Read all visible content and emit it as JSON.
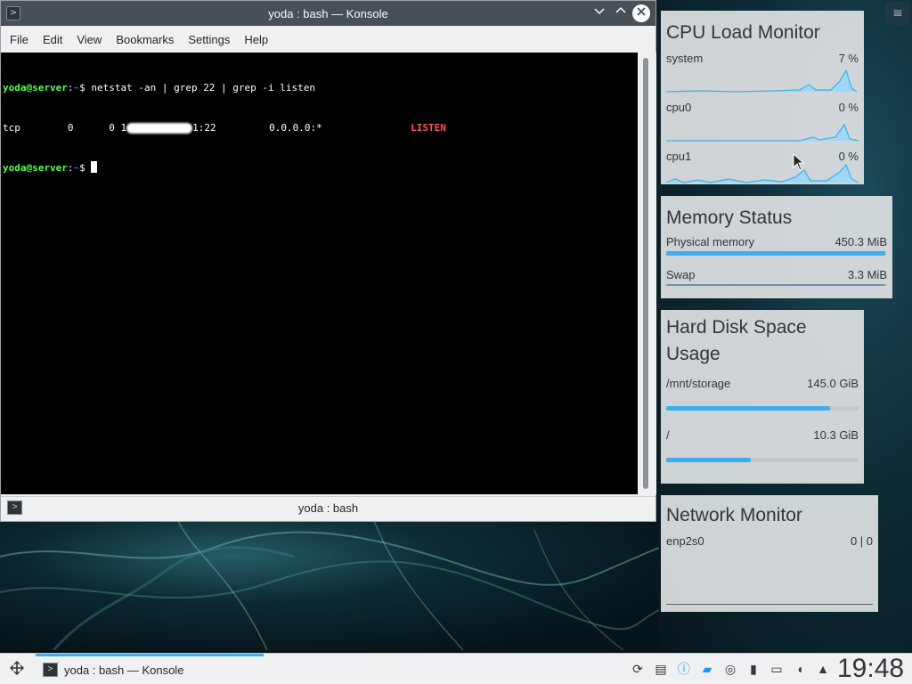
{
  "window": {
    "title": "yoda : bash — Konsole",
    "minimize_icon": "chevron-down-icon",
    "maximize_icon": "chevron-up-icon",
    "close_icon": "close-icon"
  },
  "menu": [
    "File",
    "Edit",
    "View",
    "Bookmarks",
    "Settings",
    "Help"
  ],
  "terminal": {
    "prompt_user": "yoda@server",
    "prompt_sep": ":",
    "prompt_path": "~",
    "prompt_end": "$ ",
    "command": "netstat -an | grep 22 | grep -i listen",
    "out_proto": "tcp        0      0 ",
    "out_local_prefix": "1",
    "out_local_suffix": "1:22         0.0.0.0:*               ",
    "out_state": "LISTEN"
  },
  "tab": {
    "label": "yoda : bash"
  },
  "cpu": {
    "title": "CPU Load Monitor",
    "rows": [
      {
        "name": "system",
        "value": "7 %"
      },
      {
        "name": "cpu0",
        "value": "0 %"
      },
      {
        "name": "cpu1",
        "value": "0 %"
      }
    ]
  },
  "memory": {
    "title": "Memory Status",
    "rows": [
      {
        "name": "Physical memory",
        "value": "450.3 MiB",
        "fill": 0.99
      },
      {
        "name": "Swap",
        "value": "3.3 MiB",
        "fill": 0.99
      }
    ]
  },
  "disk": {
    "title_line1": "Hard Disk Space",
    "title_line2": "Usage",
    "rows": [
      {
        "name": "/mnt/storage",
        "value": "145.0 GiB",
        "fill": 0.85
      },
      {
        "name": "/",
        "value": "10.3 GiB",
        "fill": 0.44
      }
    ]
  },
  "network": {
    "title": "Network Monitor",
    "iface": "enp2s0",
    "value": "0 | 0"
  },
  "taskbar": {
    "task_label": "yoda : bash — Konsole",
    "clock": "19:48",
    "tray_icons": [
      "updates-icon",
      "clipboard-icon",
      "info-icon",
      "notifications-icon",
      "network-vault-icon",
      "usb-device-icon",
      "network-wired-icon",
      "volume-icon",
      "expand-tray-icon"
    ]
  },
  "colors": {
    "accent": "#3daee9",
    "titlebar": "#475057",
    "listen": "#ff5454",
    "prompt": "#54ff54"
  }
}
